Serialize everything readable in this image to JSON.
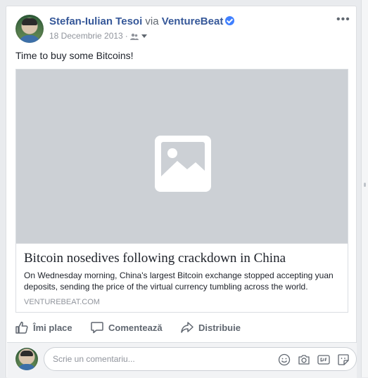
{
  "post": {
    "author": "Stefan-Iulian Tesoi",
    "via_word": "via",
    "via_page": "VentureBeat",
    "date": "18 Decembrie 2013",
    "date_separator": "·",
    "audience_icon": "friends-icon",
    "text": "Time to buy some Bitcoins!"
  },
  "link": {
    "title": "Bitcoin nosedives following crackdown in China",
    "description": "On Wednesday morning, China's largest Bitcoin exchange stopped accepting yuan deposits, sending the price of the virtual currency tumbling across the world.",
    "domain": "VENTUREBEAT.COM",
    "image_icon": "image-placeholder-icon"
  },
  "actions": {
    "like_label": "Îmi place",
    "comment_label": "Comentează",
    "share_label": "Distribuie"
  },
  "comment": {
    "placeholder": "Scrie un comentariu...",
    "icons": [
      "emoji-icon",
      "camera-icon",
      "gif-icon",
      "sticker-icon"
    ]
  },
  "colors": {
    "link_blue": "#365899",
    "verified_blue": "#4080ff",
    "muted": "#90949c",
    "action_gray": "#606770"
  }
}
